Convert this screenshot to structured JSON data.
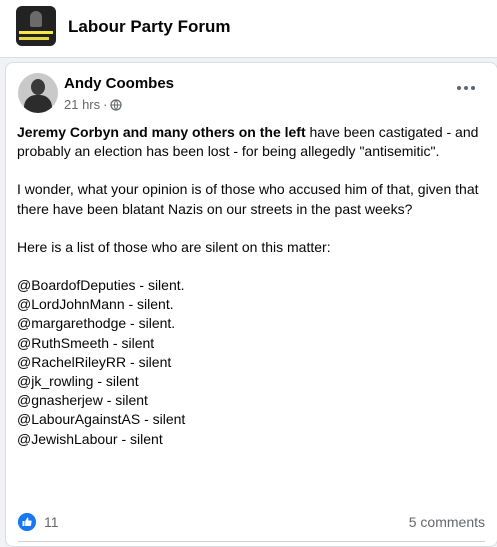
{
  "group": {
    "name": "Labour Party Forum"
  },
  "post": {
    "author": "Andy Coombes",
    "time": "21 hrs",
    "separator": "·",
    "intro_bold": "Jeremy Corbyn and many others on the left",
    "intro_rest": " have been castigated - and probably an election has been lost - for being allegedly \"antisemitic\".",
    "para2": "I wonder, what your opinion is of those who accused him of that, given that there have been blatant Nazis on our streets in the past weeks?",
    "para3": "Here is a list of those who are silent on this matter:",
    "list": [
      "@BoardofDeputies - silent.",
      "@LordJohnMann - silent.",
      "@margarethodge - silent.",
      "@RuthSmeeth - silent",
      "@RachelRileyRR - silent",
      "@jk_rowling - silent",
      "@gnasherjew - silent",
      "@LabourAgainstAS - silent",
      "@JewishLabour - silent"
    ]
  },
  "reactions": {
    "count": "11",
    "comments": "5 comments"
  },
  "icons": {
    "group_thumbnail": "group-thumbnail",
    "audience": "globe-icon",
    "menu": "more-options-icon",
    "reaction": "like-icon"
  },
  "colors": {
    "accent": "#1877f2",
    "secondary_text": "#65676b",
    "background": "#f0f2f5"
  }
}
